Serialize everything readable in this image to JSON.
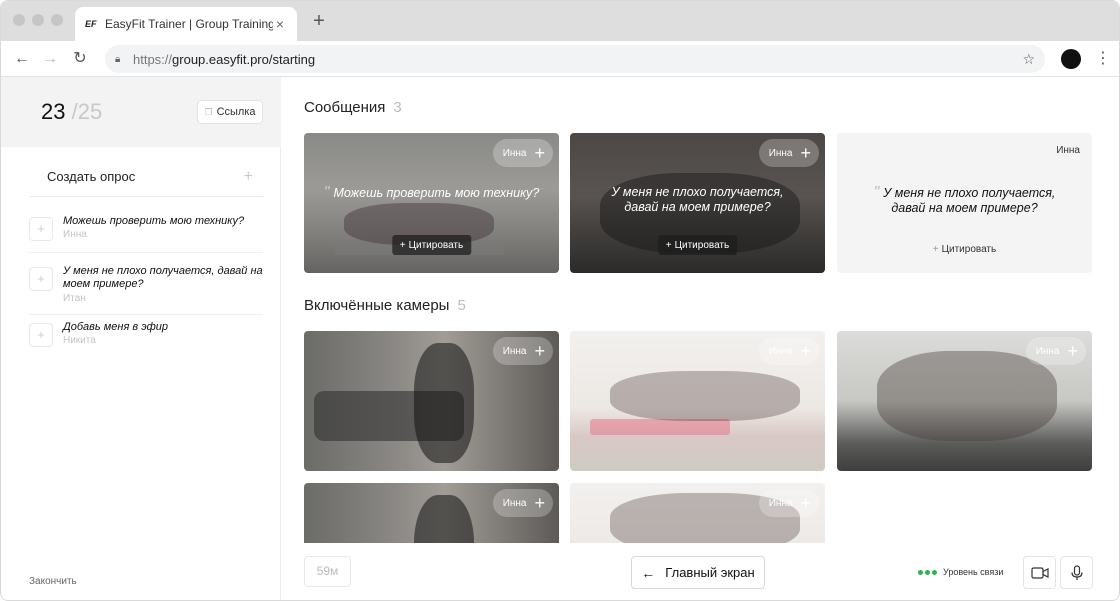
{
  "browser": {
    "tab_favicon": "EF",
    "tab_title": "EasyFit Trainer | Group Training",
    "tab_close": "×",
    "new_tab": "+",
    "url_scheme": "https://",
    "url_rest": "group.easyfit.pro/starting"
  },
  "sidebar": {
    "counter_current": "23",
    "counter_total": "/25",
    "link_label": "Ссылка",
    "create_poll_label": "Создать опрос",
    "messages": [
      {
        "text": "Можешь проверить мою технику?",
        "author": "Инна"
      },
      {
        "text": "У меня не плохо получается, давай на моем примере?",
        "author": "Итан"
      },
      {
        "text": "Добавь меня в эфир",
        "author": "Никита"
      }
    ],
    "finish_label": "Закончить"
  },
  "messages_section": {
    "title": "Сообщения",
    "count": "3",
    "cards": [
      {
        "name": "Инна",
        "quote": "Можешь проверить мою технику?",
        "cite": "Цитировать"
      },
      {
        "name": "Инна",
        "quote": "У меня не плохо получается, давай на моем примере?",
        "cite": "Цитировать"
      },
      {
        "name": "Инна",
        "quote": "У меня не плохо получается, давай на моем примере?",
        "cite": "Цитировать"
      }
    ]
  },
  "cameras_section": {
    "title": "Включённые камеры",
    "count": "5",
    "cards": [
      {
        "name": "Инна"
      },
      {
        "name": "Инна"
      },
      {
        "name": "Инна"
      },
      {
        "name": "Инна"
      },
      {
        "name": "Инна"
      }
    ]
  },
  "bottom": {
    "timer": "59м",
    "home_label": "Главный экран",
    "signal_label": "Уровень связи"
  },
  "colors": {
    "signal_good": "#2fb34f",
    "accent": "#1a1a1a"
  }
}
